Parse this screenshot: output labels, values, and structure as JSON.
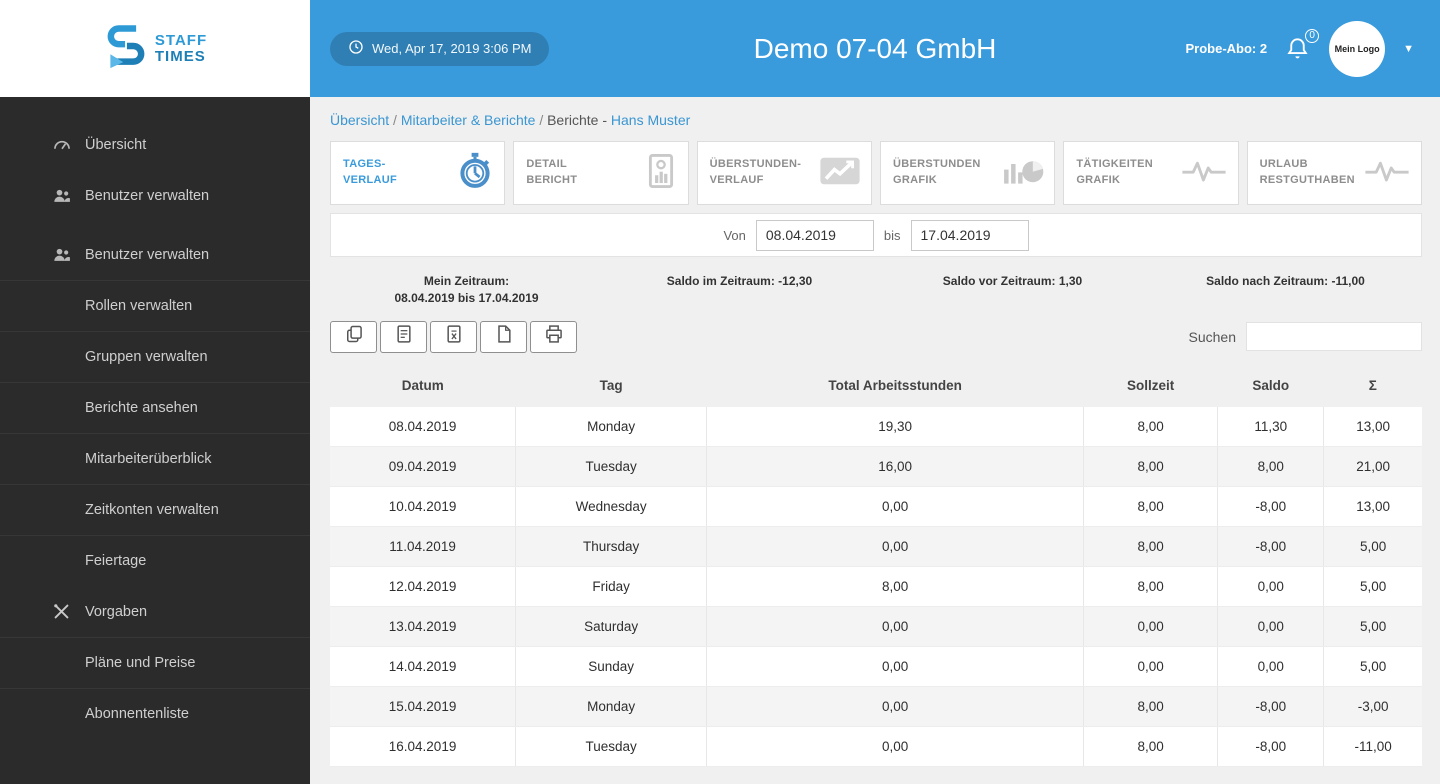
{
  "brand": {
    "line1": "STAFF",
    "line2": "TIMES"
  },
  "header": {
    "timestamp": "Wed, Apr 17, 2019 3:06 PM",
    "company": "Demo 07-04 GmbH",
    "subscription": "Probe-Abo: 2",
    "notification_count": "0",
    "avatar_label": "Mein Logo"
  },
  "sidebar": {
    "items": [
      {
        "label": "Übersicht",
        "icon": "dashboard-icon"
      },
      {
        "label": "Benutzer verwalten",
        "icon": "users-icon"
      },
      {
        "label": "Benutzer verwalten",
        "icon": "users-icon"
      },
      {
        "label": "Rollen verwalten",
        "icon": null
      },
      {
        "label": "Gruppen verwalten",
        "icon": null
      },
      {
        "label": "Berichte ansehen",
        "icon": null
      },
      {
        "label": "Mitarbeiterüberblick",
        "icon": null
      },
      {
        "label": "Zeitkonten verwalten",
        "icon": null
      },
      {
        "label": "Feiertage",
        "icon": null
      },
      {
        "label": "Vorgaben",
        "icon": "tools-icon"
      },
      {
        "label": "Pläne und Preise",
        "icon": null
      },
      {
        "label": "Abonnentenliste",
        "icon": null
      }
    ]
  },
  "breadcrumb": {
    "link1": "Übersicht",
    "separator": "/",
    "link2": "Mitarbeiter & Berichte",
    "current": "Berichte -",
    "person": "Hans Muster"
  },
  "tabs": [
    {
      "line1": "TAGES-",
      "line2": "VERLAUF",
      "active": true
    },
    {
      "line1": "DETAIL",
      "line2": "BERICHT",
      "active": false
    },
    {
      "line1": "ÜBERSTUNDEN-",
      "line2": "VERLAUF",
      "active": false
    },
    {
      "line1": "ÜBERSTUNDEN",
      "line2": "GRAFIK",
      "active": false
    },
    {
      "line1": "TÄTIGKEITEN",
      "line2": "GRAFIK",
      "active": false
    },
    {
      "line1": "URLAUB",
      "line2": "RESTGUTHABEN",
      "active": false
    }
  ],
  "date_filter": {
    "von_label": "Von",
    "von_value": "08.04.2019",
    "bis_label": "bis",
    "bis_value": "17.04.2019"
  },
  "summary": {
    "zeitraum_label": "Mein Zeitraum:",
    "zeitraum_value": "08.04.2019 bis 17.04.2019",
    "saldo_im": "Saldo im Zeitraum: -12,30",
    "saldo_vor": "Saldo vor Zeitraum: 1,30",
    "saldo_nach": "Saldo nach Zeitraum: -11,00"
  },
  "toolbar": {
    "search_label": "Suchen",
    "search_value": ""
  },
  "table": {
    "columns": [
      "Datum",
      "Tag",
      "Total Arbeitsstunden",
      "Sollzeit",
      "Saldo",
      "Σ"
    ],
    "rows": [
      [
        "08.04.2019",
        "Monday",
        "19,30",
        "8,00",
        "11,30",
        "13,00"
      ],
      [
        "09.04.2019",
        "Tuesday",
        "16,00",
        "8,00",
        "8,00",
        "21,00"
      ],
      [
        "10.04.2019",
        "Wednesday",
        "0,00",
        "8,00",
        "-8,00",
        "13,00"
      ],
      [
        "11.04.2019",
        "Thursday",
        "0,00",
        "8,00",
        "-8,00",
        "5,00"
      ],
      [
        "12.04.2019",
        "Friday",
        "8,00",
        "8,00",
        "0,00",
        "5,00"
      ],
      [
        "13.04.2019",
        "Saturday",
        "0,00",
        "0,00",
        "0,00",
        "5,00"
      ],
      [
        "14.04.2019",
        "Sunday",
        "0,00",
        "0,00",
        "0,00",
        "5,00"
      ],
      [
        "15.04.2019",
        "Monday",
        "0,00",
        "8,00",
        "-8,00",
        "-3,00"
      ],
      [
        "16.04.2019",
        "Tuesday",
        "0,00",
        "8,00",
        "-8,00",
        "-11,00"
      ]
    ]
  },
  "colors": {
    "header_blue": "#3a9bdc",
    "sidebar_dark": "#2b2b2b",
    "link_blue": "#3a96d2",
    "active_tab": "#3a9bdc"
  }
}
